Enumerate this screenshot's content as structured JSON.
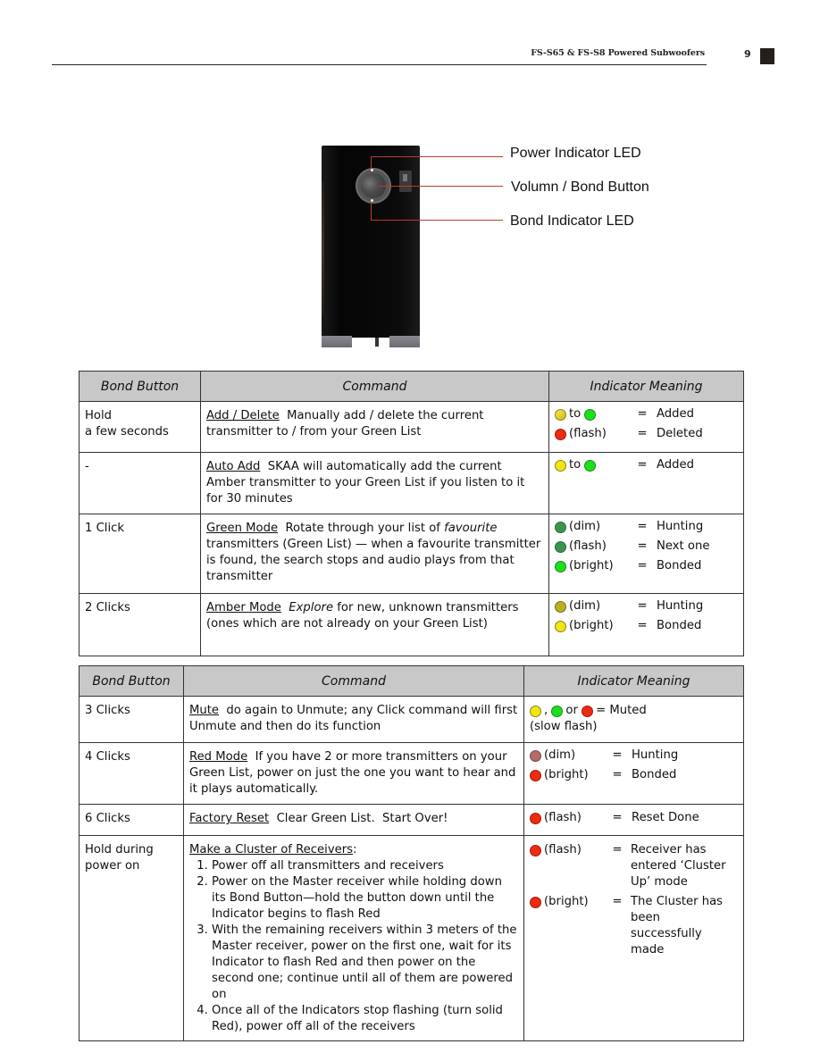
{
  "header": {
    "title": "FS-S65 & FS-S8 Powered Subwoofers",
    "page_number": "9"
  },
  "figure": {
    "callouts": [
      {
        "label": "Power Indicator LED"
      },
      {
        "label": "Volumn / Bond Button"
      },
      {
        "label": "Bond Indicator LED"
      }
    ]
  },
  "colors": {
    "header_fill": "#c8c8c8",
    "led_yellow": "#f2e60c",
    "led_green_bright": "#1be01b",
    "led_green_dim": "#3c9350",
    "led_red": "#ee2a10",
    "led_red_dim": "#b26c6a",
    "led_amber_dim": "#b8b020",
    "callout_line": "#c0392b"
  },
  "table_headers": {
    "bond_button": "Bond Button",
    "command": "Command",
    "indicator_meaning": "Indicator Meaning"
  },
  "table_a": {
    "rows": [
      {
        "button": [
          "Hold",
          "a few seconds"
        ],
        "cmd_name": "Add / Delete",
        "cmd_text": "Manually add / delete the current transmitter to / from your Green List",
        "indicators": [
          {
            "leds": [
              "yellow-grad",
              "green"
            ],
            "connector": "to",
            "state": "",
            "eq": "=",
            "meaning": "Added"
          },
          {
            "leds": [
              "red"
            ],
            "connector": "",
            "state": "(flash)",
            "eq": "=",
            "meaning": "Deleted"
          }
        ]
      },
      {
        "button": [
          "-"
        ],
        "cmd_name": "Auto Add",
        "cmd_text": "SKAA will automatically add the current Amber transmitter to your Green List if you listen to it for 30 minutes",
        "indicators": [
          {
            "leds": [
              "yellow",
              "green"
            ],
            "connector": "to",
            "state": "",
            "eq": "=",
            "meaning": "Added"
          }
        ]
      },
      {
        "button": [
          "1 Click"
        ],
        "cmd_name": "Green Mode",
        "cmd_text_pre": "Rotate through your list of",
        "cmd_italic": "favourite",
        "cmd_text_post": "transmitters (Green List) — when a favourite transmitter is found, the search stops and audio plays from that transmitter",
        "indicators": [
          {
            "leds": [
              "dim-green"
            ],
            "state": "(dim)",
            "eq": "=",
            "meaning": "Hunting"
          },
          {
            "leds": [
              "dim-green"
            ],
            "state": "(flash)",
            "eq": "=",
            "meaning": "Next one"
          },
          {
            "leds": [
              "green"
            ],
            "state": "(bright)",
            "eq": "=",
            "meaning": "Bonded"
          }
        ]
      },
      {
        "button": [
          "2 Clicks"
        ],
        "cmd_name": "Amber Mode",
        "cmd_italic": "Explore",
        "cmd_text_post": "for new, unknown transmitters (ones which are not already on your Green List)",
        "indicators": [
          {
            "leds": [
              "dim-amber"
            ],
            "state": "(dim)",
            "eq": "=",
            "meaning": "Hunting"
          },
          {
            "leds": [
              "yellow"
            ],
            "state": "(bright)",
            "eq": "=",
            "meaning": "Bonded"
          }
        ]
      }
    ]
  },
  "table_b": {
    "rows": [
      {
        "button": [
          "3 Clicks"
        ],
        "cmd_name": "Mute",
        "cmd_text": "do again to Unmute; any Click command will first Unmute and then do its function",
        "indicator_sep1": ",",
        "indicator_sep2": "or",
        "indicator_eq": "=",
        "indicator_meaning": "Muted",
        "indicator_note": "(slow flash)"
      },
      {
        "button": [
          "4 Clicks"
        ],
        "cmd_name": "Red Mode",
        "cmd_text": "If you have 2 or more transmitters on your Green List, power on just the one you want to hear and it plays automatically.",
        "indicators": [
          {
            "leds": [
              "dim-red"
            ],
            "state": "(dim)",
            "eq": "=",
            "meaning": "Hunting"
          },
          {
            "leds": [
              "red"
            ],
            "state": "(bright)",
            "eq": "=",
            "meaning": "Bonded"
          }
        ]
      },
      {
        "button": [
          "6 Clicks"
        ],
        "cmd_name": "Factory Reset",
        "cmd_text": "Clear Green List.  Start Over!",
        "indicators": [
          {
            "leds": [
              "red"
            ],
            "state": "(flash)",
            "eq": "=",
            "meaning": "Reset Done"
          }
        ]
      },
      {
        "button": [
          "Hold during",
          "power on"
        ],
        "cmd_name": "Make a Cluster of Receivers",
        "cmd_suffix": ":",
        "steps": [
          "Power off all transmitters and receivers",
          "Power on the Master receiver while holding down its Bond Button—hold the button down until the Indicator begins to flash Red",
          "With the remaining receivers within 3 meters of the Master receiver, power on the first one, wait for its Indicator to flash Red and then power on the second one; continue until all of them are powered on",
          "Once all of the Indicators stop flashing (turn solid Red), power off all of the receivers"
        ],
        "indicators": [
          {
            "leds": [
              "red"
            ],
            "state": "(flash)",
            "eq": "=",
            "meaning_lines": [
              "Receiver has",
              "entered ‘Cluster",
              "Up’ mode"
            ]
          },
          {
            "leds": [
              "red"
            ],
            "state": "(bright)",
            "eq": "=",
            "meaning_lines": [
              "The Cluster has",
              "been",
              "successfully",
              "made"
            ]
          }
        ]
      }
    ]
  }
}
